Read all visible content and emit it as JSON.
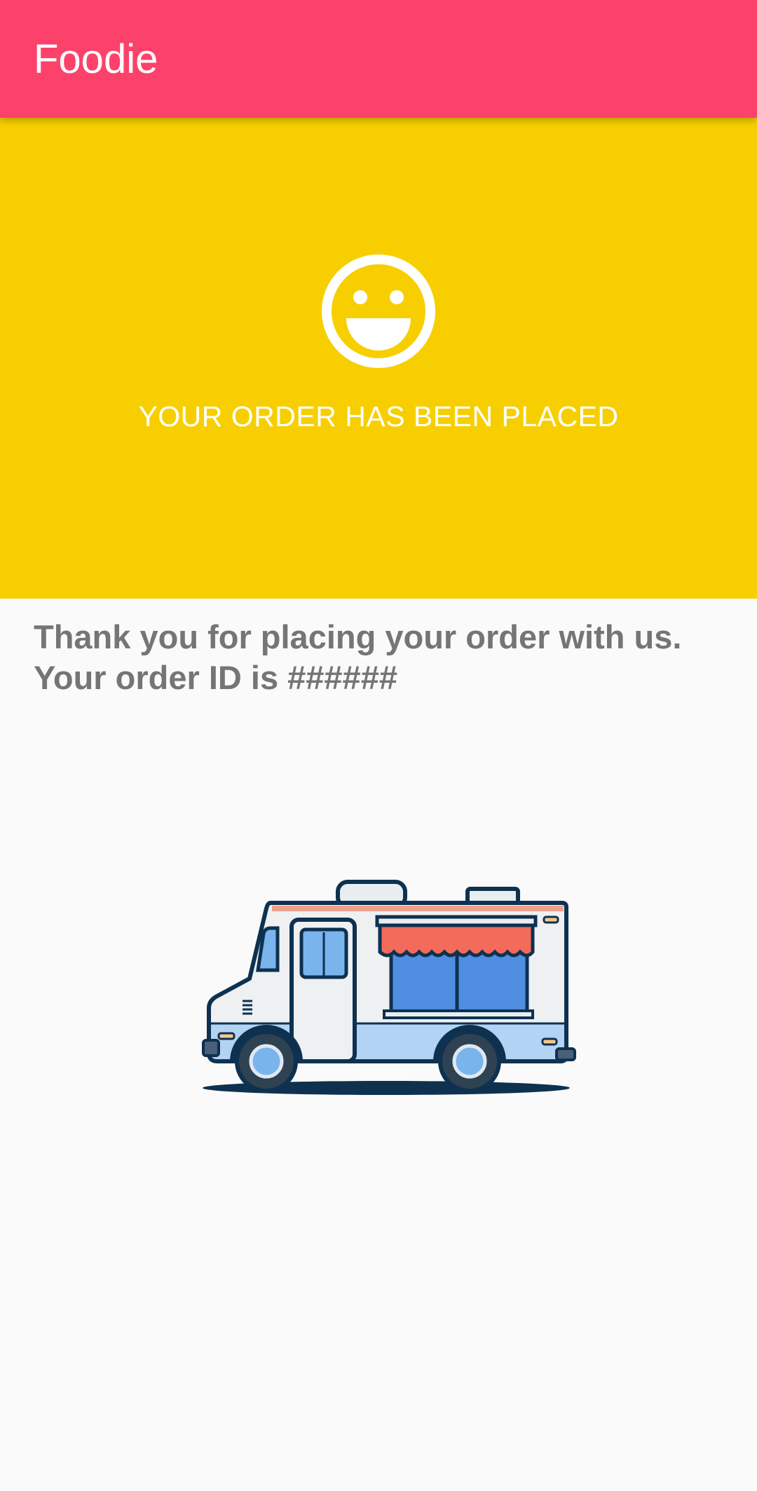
{
  "app_bar": {
    "title": "Foodie",
    "color": "#fc426a"
  },
  "hero": {
    "background": "#f7cf00",
    "icon": "smiley-face-icon",
    "message": "YOUR ORDER HAS BEEN PLACED"
  },
  "confirmation": {
    "line1": "Thank you for placing your order with us.",
    "line2": "Your order ID is ######"
  },
  "illustration": {
    "icon": "food-truck-icon"
  }
}
